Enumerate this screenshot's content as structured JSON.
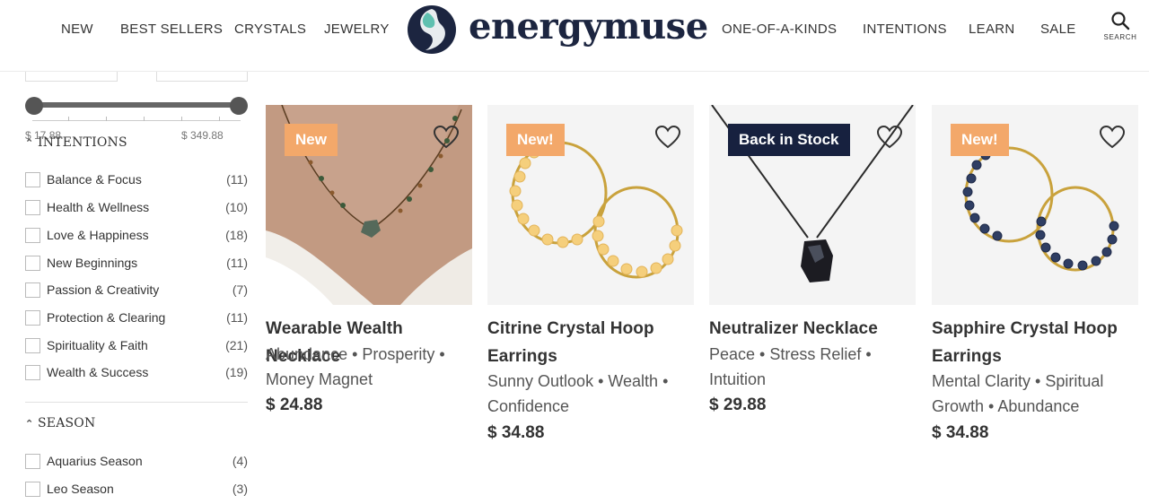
{
  "header": {
    "nav_left": [
      "NEW",
      "BEST SELLERS",
      "CRYSTALS",
      "JEWELRY"
    ],
    "logo_text": "energymuse",
    "nav_right": [
      "ONE-OF-A-KINDS",
      "INTENTIONS",
      "LEARN",
      "SALE"
    ],
    "search_label": "SEARCH",
    "search_icon": "search-icon"
  },
  "sidebar": {
    "price": {
      "min_label": "$ 17.88",
      "max_label": "$ 349.88"
    },
    "intentions": {
      "title": "INTENTIONS",
      "items": [
        {
          "label": "Balance & Focus",
          "count": "(11)"
        },
        {
          "label": "Health & Wellness",
          "count": "(10)"
        },
        {
          "label": "Love & Happiness",
          "count": "(18)"
        },
        {
          "label": "New Beginnings",
          "count": "(11)"
        },
        {
          "label": "Passion & Creativity",
          "count": "(7)"
        },
        {
          "label": "Protection & Clearing",
          "count": "(11)"
        },
        {
          "label": "Spirituality & Faith",
          "count": "(21)"
        },
        {
          "label": "Wealth & Success",
          "count": "(19)"
        }
      ]
    },
    "season": {
      "title": "SEASON",
      "items": [
        {
          "label": "Aquarius Season",
          "count": "(4)"
        },
        {
          "label": "Leo Season",
          "count": "(3)"
        }
      ]
    }
  },
  "products": [
    {
      "badge": "New",
      "badge_color": "#f3a86a",
      "name": "Wearable Wealth Necklace",
      "tags": "Abundance • Prosperity • Money Magnet",
      "price": "$ 24.88"
    },
    {
      "badge": "New!",
      "badge_color": "#f3a86a",
      "name": "Citrine Crystal Hoop Earrings",
      "tags": "Sunny Outlook • Wealth • Confidence",
      "price": "$ 34.88"
    },
    {
      "badge": "Back in Stock",
      "badge_color": "#17213f",
      "name": "Neutralizer Necklace",
      "tags": "Peace • Stress Relief • Intuition",
      "price": "$ 29.88"
    },
    {
      "badge": "New!",
      "badge_color": "#f3a86a",
      "name": "Sapphire Crystal Hoop Earrings",
      "tags": "Mental Clarity • Spiritual Growth • Abundance",
      "price": "$ 34.88"
    }
  ],
  "colors": {
    "brand_navy": "#1c2540",
    "brand_teal": "#5fc0b0",
    "badge_orange": "#f3a86a"
  }
}
